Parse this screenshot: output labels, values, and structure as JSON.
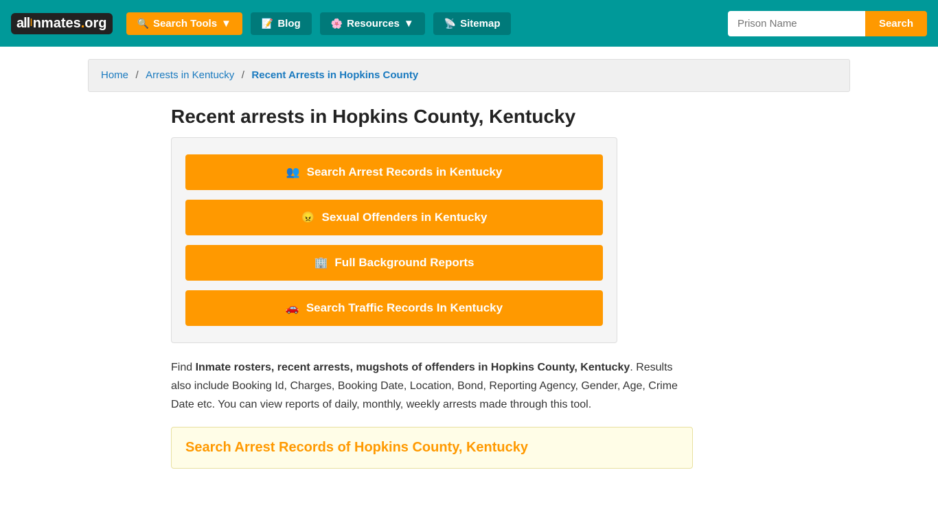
{
  "header": {
    "logo": {
      "part1": "all",
      "part2": "I",
      "part3": "nmates",
      "dot": ".",
      "part4": "org"
    },
    "nav": {
      "search_tools": "Search Tools",
      "blog": "Blog",
      "resources": "Resources",
      "sitemap": "Sitemap"
    },
    "search_placeholder": "Prison Name",
    "search_button": "Search"
  },
  "breadcrumb": {
    "home": "Home",
    "arrests_in_kentucky": "Arrests in Kentucky",
    "current": "Recent Arrests in Hopkins County"
  },
  "page": {
    "title": "Recent arrests in Hopkins County, Kentucky",
    "buttons": [
      {
        "label": "Search Arrest Records in Kentucky",
        "icon": "people"
      },
      {
        "label": "Sexual Offenders in Kentucky",
        "icon": "face"
      },
      {
        "label": "Full Background Reports",
        "icon": "building"
      },
      {
        "label": "Search Traffic Records In Kentucky",
        "icon": "car"
      }
    ],
    "description_plain": ". Results also include Booking Id, Charges, Booking Date, Location, Bond, Reporting Agency, Gender, Age, Crime Date etc. You can view reports of daily, monthly, weekly arrests made through this tool.",
    "description_bold": "Inmate rosters, recent arrests, mugshots of offenders in Hopkins County, Kentucky",
    "description_prefix": "Find ",
    "search_section_title": "Search Arrest Records of Hopkins County, Kentucky"
  }
}
